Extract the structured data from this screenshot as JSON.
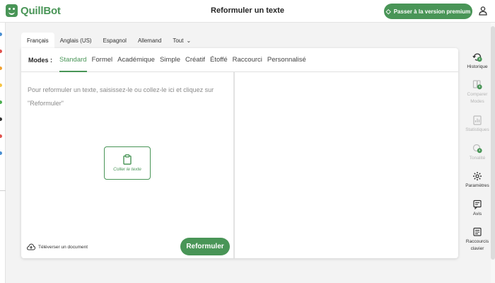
{
  "app": {
    "logo_text": "QuillBot",
    "page_title": "Reformuler un texte",
    "premium_label": "Passer à la version premium",
    "brand_color": "#499557"
  },
  "language_tabs": [
    {
      "label": "Français",
      "active": true
    },
    {
      "label": "Anglais (US)",
      "active": false
    },
    {
      "label": "Espagnol",
      "active": false
    },
    {
      "label": "Allemand",
      "active": false
    },
    {
      "label": "Tout",
      "active": false
    }
  ],
  "modes": {
    "label": "Modes :",
    "items": [
      "Standard",
      "Formel",
      "Académique",
      "Simple",
      "Créatif",
      "Étoffé",
      "Raccourci",
      "Personnalisé"
    ],
    "active": "Standard"
  },
  "editor": {
    "placeholder": "Pour reformuler un texte, saisissez-le ou collez-le ici et cliquez sur \"Reformuler\"",
    "paste_label": "Coller le texte",
    "upload_label": "Téléverser un document",
    "rephrase_label": "Reformuler"
  },
  "sidebar": {
    "items": [
      {
        "label": "Historique",
        "icon": "history-icon",
        "enabled": true
      },
      {
        "label": "Comparer Modes",
        "icon": "compare-modes-icon",
        "enabled": false
      },
      {
        "label": "Statistiques",
        "icon": "statistics-icon",
        "enabled": false
      },
      {
        "label": "Tonalité",
        "icon": "tone-icon",
        "enabled": false
      },
      {
        "label": "Paramètres",
        "icon": "gear-icon",
        "enabled": true
      },
      {
        "label": "Avis",
        "icon": "feedback-icon",
        "enabled": true
      },
      {
        "label": "Raccourcis clavier",
        "icon": "keyboard-icon",
        "enabled": true
      }
    ]
  }
}
